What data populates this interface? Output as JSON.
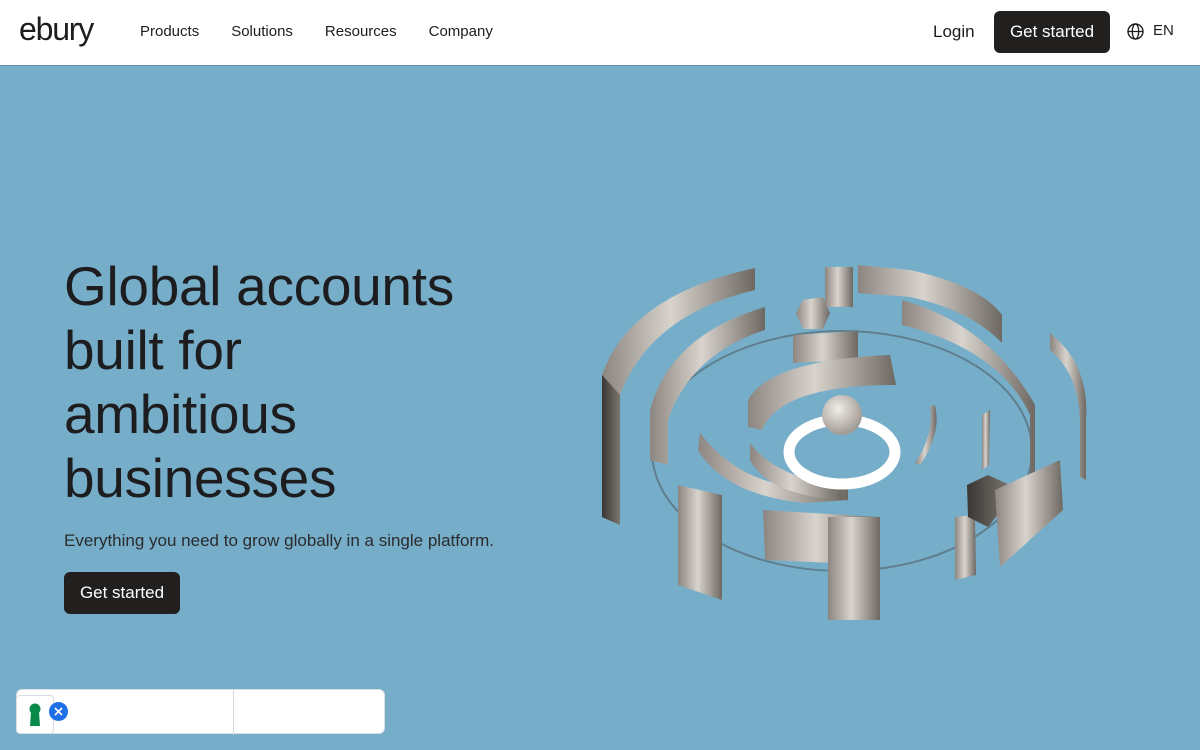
{
  "header": {
    "logo_text": "ebury",
    "nav": [
      {
        "label": "Products"
      },
      {
        "label": "Solutions"
      },
      {
        "label": "Resources"
      },
      {
        "label": "Company"
      }
    ],
    "login_label": "Login",
    "cta_label": "Get started",
    "language": {
      "icon": "globe-icon",
      "label": "EN"
    }
  },
  "hero": {
    "title_lines": [
      "Global accounts",
      "built for",
      "ambitious",
      "businesses"
    ],
    "subtitle": "Everything you need to grow globally in a single platform.",
    "cta_label": "Get started",
    "illustration": "3d-circular-maze-illustration"
  },
  "consent_widget": {
    "icon": "keyhole-icon",
    "close_icon": "close-icon"
  },
  "colors": {
    "background": "#76aeca",
    "header_bg": "#ffffff",
    "button_dark": "#221f1f",
    "close_badge": "#1f6fe6",
    "keyhole_green": "#0a8a4a"
  }
}
